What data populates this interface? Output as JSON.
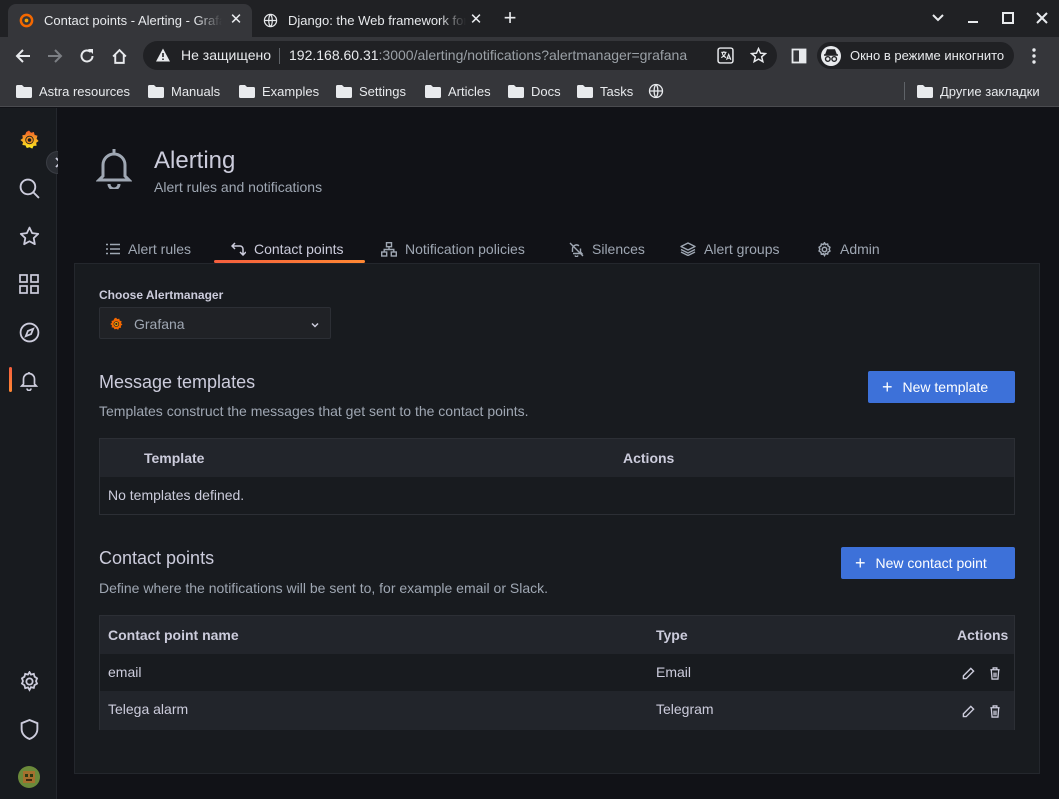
{
  "browser": {
    "tabs": [
      {
        "title": "Contact points - Alerting - Grafana"
      },
      {
        "title": "Django: the Web framework for perfectionists with deadlines"
      }
    ],
    "omnibox": {
      "security_warning": "Не защищено",
      "host": "192.168.60.31",
      "path": ":3000/alerting/notifications?alertmanager=grafana"
    },
    "incognito_label": "Окно в режиме инкогнито",
    "bookmarks": [
      "Astra resources",
      "Manuals",
      "Examples",
      "Settings",
      "Articles",
      "Docs",
      "Tasks"
    ],
    "other_bookmarks": "Другие закладки"
  },
  "header": {
    "title": "Alerting",
    "subtitle": "Alert rules and notifications"
  },
  "tabs": [
    {
      "label": "Alert rules",
      "icon": "list-icon"
    },
    {
      "label": "Contact points",
      "icon": "comment-alt-share-icon"
    },
    {
      "label": "Notification policies",
      "icon": "sitemap-icon"
    },
    {
      "label": "Silences",
      "icon": "bell-slash-icon"
    },
    {
      "label": "Alert groups",
      "icon": "layer-group-icon"
    },
    {
      "label": "Admin",
      "icon": "cog-icon"
    }
  ],
  "alertmanager": {
    "label": "Choose Alertmanager",
    "value": "Grafana"
  },
  "templates": {
    "title": "Message templates",
    "description": "Templates construct the messages that get sent to the contact points.",
    "button": "New template",
    "columns": [
      "Template",
      "Actions"
    ],
    "empty": "No templates defined."
  },
  "contacts": {
    "title": "Contact points",
    "description": "Define where the notifications will be sent to, for example email or Slack.",
    "button": "New contact point",
    "columns": [
      "Contact point name",
      "Type",
      "Actions"
    ],
    "rows": [
      {
        "name": "email",
        "type": "Email"
      },
      {
        "name": "Telega alarm",
        "type": "Telegram"
      }
    ]
  },
  "colors": {
    "primary": "#3d71d9",
    "accent_gradient": [
      "#f55f3e",
      "#ff8833"
    ],
    "background": "#111217",
    "panel": "#181b1f"
  }
}
